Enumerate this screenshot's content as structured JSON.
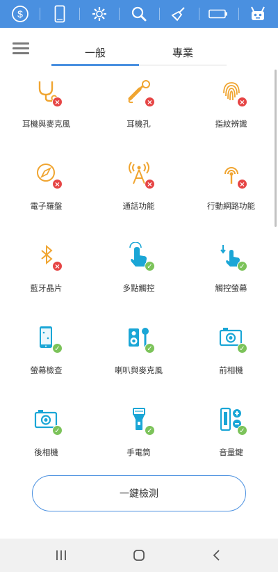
{
  "toolbar": {
    "items": [
      {
        "icon": "dollar-icon"
      },
      {
        "icon": "phone-icon"
      },
      {
        "icon": "gear-icon"
      },
      {
        "icon": "search-icon"
      },
      {
        "icon": "broom-icon"
      },
      {
        "icon": "battery-icon"
      },
      {
        "icon": "robot-icon"
      }
    ],
    "background": "#4a90e0"
  },
  "tabs": [
    {
      "label": "一般",
      "active": true
    },
    {
      "label": "專業",
      "active": false
    }
  ],
  "tests": [
    {
      "label": "耳機與麥克風",
      "icon": "headset-stethoscope-icon",
      "status": "fail"
    },
    {
      "label": "耳機孔",
      "icon": "headphone-jack-icon",
      "status": "fail"
    },
    {
      "label": "指紋辨識",
      "icon": "fingerprint-icon",
      "status": "fail"
    },
    {
      "label": "電子羅盤",
      "icon": "compass-icon",
      "status": "fail"
    },
    {
      "label": "通話功能",
      "icon": "signal-tower-icon",
      "status": "fail"
    },
    {
      "label": "行動網路功能",
      "icon": "mobile-network-icon",
      "status": "fail"
    },
    {
      "label": "藍牙晶片",
      "icon": "bluetooth-icon",
      "status": "fail"
    },
    {
      "label": "多點觸控",
      "icon": "multitouch-icon",
      "status": "pass"
    },
    {
      "label": "觸控螢幕",
      "icon": "touchscreen-icon",
      "status": "pass"
    },
    {
      "label": "螢幕檢查",
      "icon": "screen-check-icon",
      "status": "pass"
    },
    {
      "label": "喇叭與麥克風",
      "icon": "speaker-mic-icon",
      "status": "pass"
    },
    {
      "label": "前相機",
      "icon": "front-camera-icon",
      "status": "pass"
    },
    {
      "label": "後相機",
      "icon": "rear-camera-icon",
      "status": "pass"
    },
    {
      "label": "手電筒",
      "icon": "flashlight-icon",
      "status": "pass"
    },
    {
      "label": "音量鍵",
      "icon": "volume-keys-icon",
      "status": "pass"
    }
  ],
  "one_key_button": "一鍵檢測",
  "nav": [
    {
      "icon": "recent-apps-icon"
    },
    {
      "icon": "home-icon"
    },
    {
      "icon": "back-icon"
    }
  ],
  "colors": {
    "accent": "#4a90e0",
    "warning_icon": "#f0a531",
    "ok_icon": "#1aa6d6",
    "fail_badge": "#e64545",
    "pass_badge": "#7cc35a"
  }
}
